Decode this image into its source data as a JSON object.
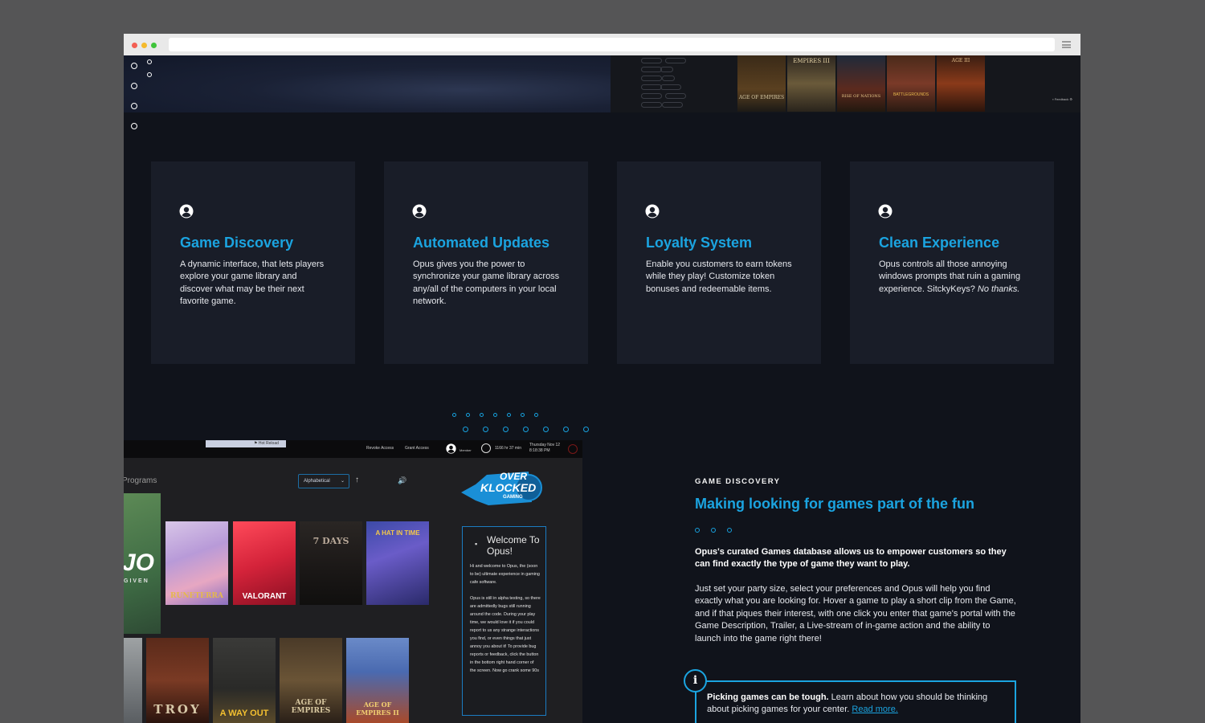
{
  "features": [
    {
      "title": "Game Discovery",
      "text": "A dynamic interface, that lets players explore your game library and discover what may be their next favorite game.",
      "emph": ""
    },
    {
      "title": "Automated Updates",
      "text": "Opus gives you the power to synchronize your game library across any/all of the computers in your local network.",
      "emph": ""
    },
    {
      "title": "Loyalty System",
      "text": "Enable you customers to earn tokens while they play! Customize token bonuses and redeemable items.",
      "emph": ""
    },
    {
      "title": "Clean Experience",
      "text": "Opus controls all those annoying windows prompts that ruin a gaming experience. SitckyKeys? ",
      "emph": "No thanks."
    }
  ],
  "section": {
    "eyebrow": "GAME DISCOVERY",
    "headline": "Making looking for games part of the fun",
    "lead": "Opus's curated Games database allows us to empower customers so they can find exactly the type of game they want to play.",
    "body": "Just set your party size, select your preferences and Opus will help you find exactly what you are looking for. Hover a game to play a short clip from the Game, and if that piques their interest, with one click you enter that game's portal with the Game Description, Trailer, a Live-stream of in-game action and the ability to launch into the game right there!",
    "callout_bold": "Picking games can be tough.",
    "callout_text": " Learn about how you should be thinking about picking games for your center. ",
    "callout_link": "Read more."
  },
  "screenshot": {
    "hot_reload": "Hot Reload",
    "revoke": "Revoke Access",
    "grant": "Grant Access",
    "user": "Member",
    "timer": "1166 hr 37 min",
    "date": "Thursday Nov 12",
    "time": "8:18:38 PM",
    "programs": "Programs",
    "sort": "Alphabetical",
    "logo_line1": "OVER",
    "logo_line2": "KLOCKED",
    "logo_line3": "GAMING",
    "welcome_title": "Welcome To Opus!",
    "welcome_text": "Hi and welcome to Opus, the (soon to be) ultimate experience in gaming cafe software.\n\nOpus is still in alpha testing, so there are admittedly bugs still running around the code. During your play time, we would love it if you could report to us any strange interactions you find, or even things that just annoy you about it! To provide bug reports or feedback, click the button in the bottom right hand corner of the screen. Now go crank some 90s",
    "tiles_row1": [
      "RUNETERRA",
      "VALORANT",
      "7 DAYS",
      "A HAT IN TIME"
    ],
    "tiles_row2": [
      "TROY",
      "A WAY OUT",
      "AGE OF EMPIRES",
      "AGE OF EMPIRES II"
    ],
    "partial_tile": "JO",
    "partial_sub": "GIVEN"
  },
  "hero": {
    "feedback": "Feedback",
    "covers": [
      "AGE OF EMPIRES",
      "EMPIRES III",
      "RISE OF NATIONS",
      "BATTLEGROUNDS",
      "AGE III"
    ]
  },
  "colors": {
    "accent": "#1ba4e0",
    "card": "#191d28",
    "page": "#10131b"
  }
}
